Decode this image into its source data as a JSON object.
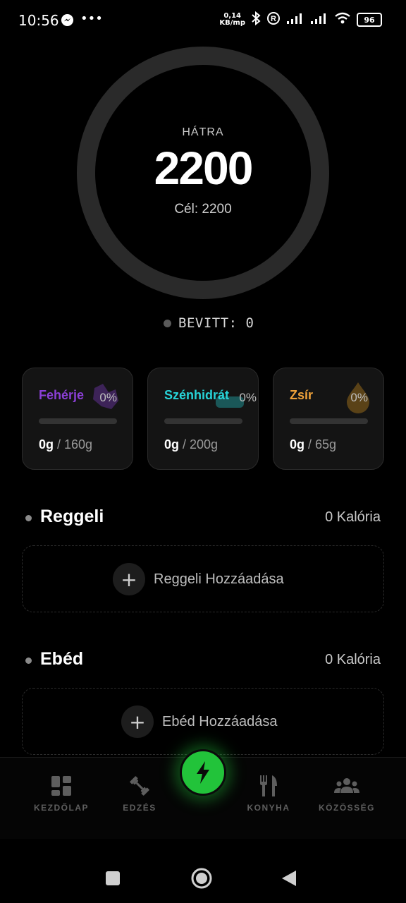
{
  "status_bar": {
    "time": "10:56",
    "net_speed_value": "0,14",
    "net_speed_unit": "KB/mp",
    "battery": "96",
    "icons": [
      "messenger-icon",
      "more-icon",
      "bluetooth-icon",
      "registered-icon",
      "signal-icon",
      "signal-icon",
      "wifi-icon",
      "battery-icon"
    ]
  },
  "summary": {
    "remaining_label": "HÁTRA",
    "remaining_value": "2200",
    "goal_text": "Cél: 2200",
    "intake_text": "BEVITT: 0"
  },
  "macros": [
    {
      "name": "Fehérje",
      "percent": "0%",
      "current": "0g",
      "total": " / 160g",
      "color": "#8b3fd6",
      "progress": 0
    },
    {
      "name": "Szénhidrát",
      "percent": "0%",
      "current": "0g",
      "total": " / 200g",
      "color": "#27d3d8",
      "progress": 0
    },
    {
      "name": "Zsír",
      "percent": "0%",
      "current": "0g",
      "total": " / 65g",
      "color": "#f0a23a",
      "progress": 0
    }
  ],
  "meals": [
    {
      "title": "Reggeli",
      "calories": "0 Kalória",
      "add_label": "Reggeli Hozzáadása"
    },
    {
      "title": "Ebéd",
      "calories": "0 Kalória",
      "add_label": "Ebéd Hozzáadása"
    }
  ],
  "nav": {
    "home": "KEZDŐLAP",
    "workout": "EDZÉS",
    "kitchen": "KONYHA",
    "community": "KÖZÖSSÉG"
  },
  "colors": {
    "accent_green": "#22c33a",
    "background": "#000000",
    "card": "#141414"
  }
}
